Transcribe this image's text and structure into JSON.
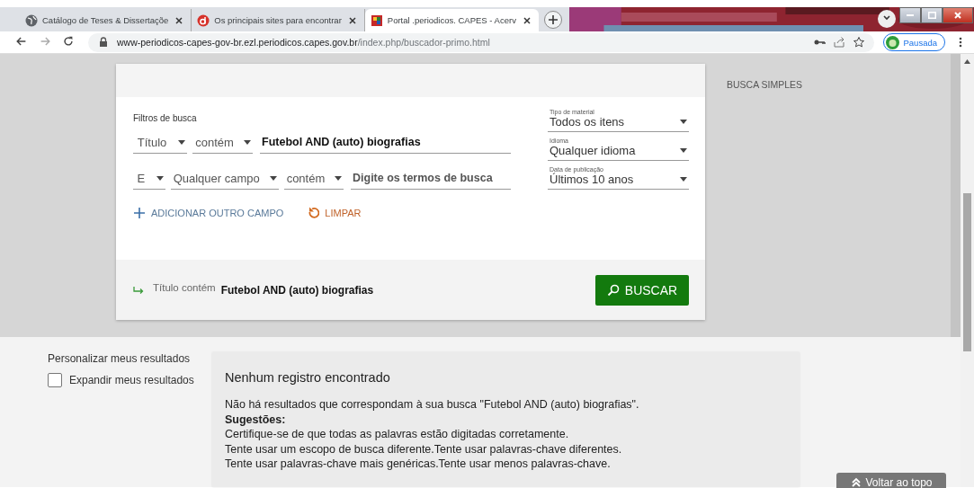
{
  "browser": {
    "tabs": [
      {
        "title": "Catálogo de Teses & Dissertaçõe",
        "selected": false
      },
      {
        "title": "Os principais sites para encontrar",
        "selected": false
      },
      {
        "title": "Portal .periodicos. CAPES - Acerv",
        "selected": true
      }
    ],
    "address": {
      "host": "www-periodicos-capes-gov-br.ezl.periodicos.capes.gov.br",
      "path": "/index.php/buscador-primo.html"
    },
    "profile": "Pausada"
  },
  "page": {
    "mode_label": "BUSCA SIMPLES",
    "filters": {
      "title": "Filtros de busca",
      "rows": [
        {
          "fields": [
            {
              "kind": "select",
              "value": "Título"
            },
            {
              "kind": "select",
              "value": "contém"
            },
            {
              "kind": "input",
              "value": "Futebol AND (auto) biografias"
            }
          ]
        },
        {
          "fields": [
            {
              "kind": "select",
              "value": "E"
            },
            {
              "kind": "select",
              "value": "Qualquer campo"
            },
            {
              "kind": "select",
              "value": "contém"
            },
            {
              "kind": "input",
              "placeholder": "Digite os termos de busca"
            }
          ]
        }
      ],
      "side": [
        {
          "label": "Tipo de material",
          "value": "Todos os itens"
        },
        {
          "label": "Idioma",
          "value": "Qualquer idioma"
        },
        {
          "label": "Data de publicação",
          "value": "Últimos 10 anos"
        }
      ],
      "add_field": "ADICIONAR OUTRO CAMPO",
      "clear": "LIMPAR"
    },
    "summary": {
      "field": "Título",
      "operator": "contém",
      "query": "Futebol AND (auto) biografias"
    },
    "search_button": "BUSCAR",
    "personalize": {
      "title": "Personalizar meus resultados",
      "checkbox": {
        "label": "Expandir meus resultados",
        "checked": false
      }
    },
    "results": {
      "title": "Nenhum registro encontrado",
      "message": "Não há resultados que correspondam à sua busca \"Futebol AND (auto) biografias\".",
      "suggestions_heading": "Sugestões:",
      "suggestions": [
        "Certifique-se de que todas as palavras estão digitadas corretamente.",
        "Tente usar um escopo de busca diferente.Tente usar palavras-chave diferentes.",
        "Tente usar palavras-chave mais genéricas.Tente usar menos palavras-chave."
      ]
    },
    "back_to_top": "Voltar ao topo"
  }
}
